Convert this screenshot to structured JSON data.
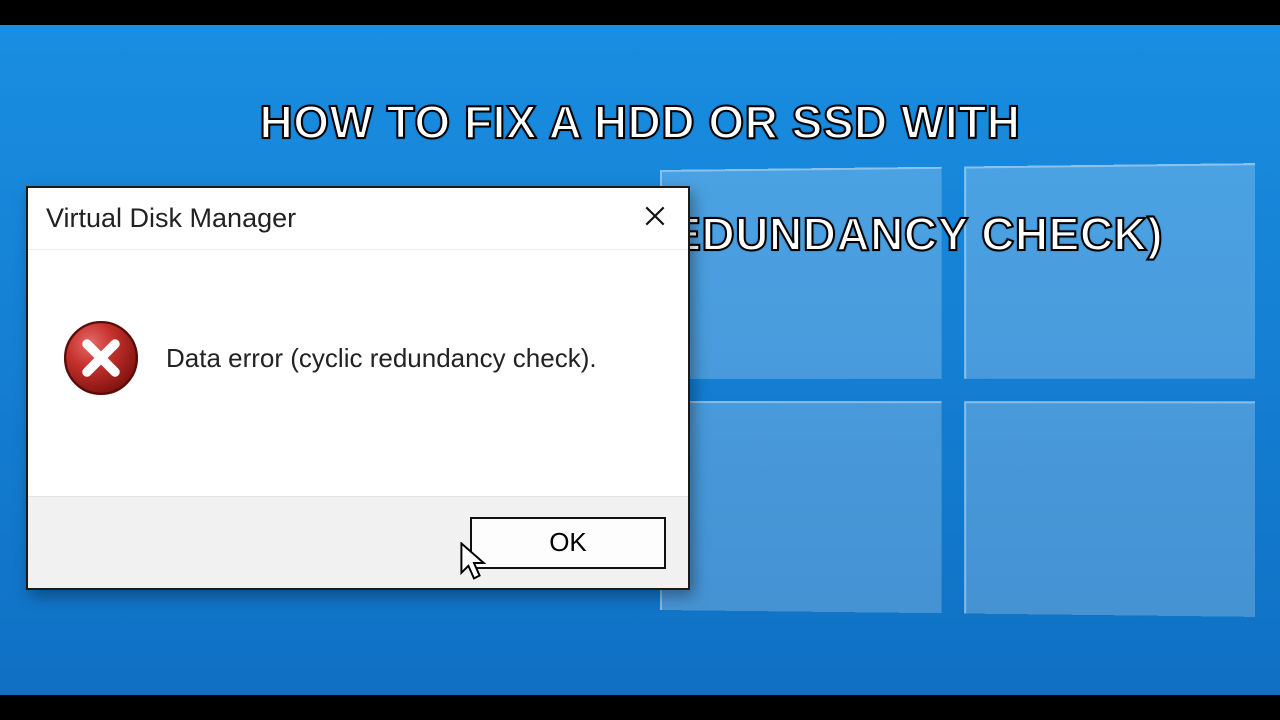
{
  "headline": {
    "line1": "HOW TO FIX A HDD OR SSD WITH",
    "line2": "DATA ERROR (CYCLIC REDUNDANCY CHECK)"
  },
  "dialog": {
    "title": "Virtual Disk Manager",
    "message": "Data error (cyclic redundancy check).",
    "ok_label": "OK"
  },
  "colors": {
    "bg_top": "#1a8fe3",
    "bg_bottom": "#0f6fc2",
    "error_red": "#b5201f"
  }
}
